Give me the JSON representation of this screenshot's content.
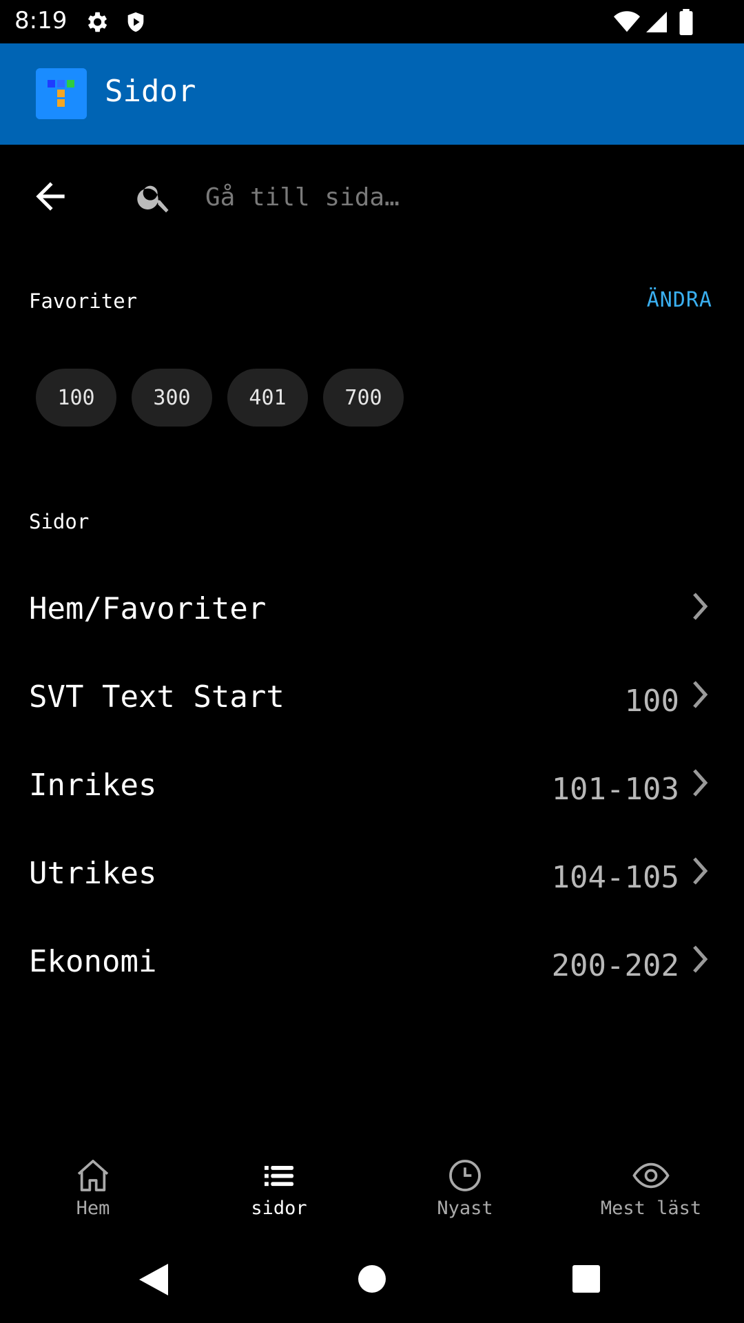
{
  "status_bar": {
    "time": "8:19",
    "icons": [
      "gear-icon",
      "shield-icon",
      "wifi-icon",
      "signal-icon",
      "battery-icon"
    ]
  },
  "app_bar": {
    "title": "Sidor",
    "logo_colors": [
      "#1e5bff",
      "#2ecc40",
      "#1e90ff",
      "#f5a623",
      "#f5a623"
    ]
  },
  "search": {
    "placeholder": "Gå till sida…",
    "value": ""
  },
  "favorites": {
    "heading": "Favoriter",
    "edit_label": "ÄNDRA",
    "chips": [
      "100",
      "300",
      "401",
      "700"
    ]
  },
  "pages": {
    "heading": "Sidor",
    "items": [
      {
        "label": "Hem/Favoriter",
        "range": ""
      },
      {
        "label": "SVT Text Start",
        "range": "100"
      },
      {
        "label": "Inrikes",
        "range": "101-103"
      },
      {
        "label": "Utrikes",
        "range": "104-105"
      },
      {
        "label": "Ekonomi",
        "range": "200-202"
      }
    ]
  },
  "bottom_nav": {
    "items": [
      {
        "label": "Hem",
        "icon": "home-icon",
        "active": false
      },
      {
        "label": "sidor",
        "icon": "list-icon",
        "active": true
      },
      {
        "label": "Nyast",
        "icon": "clock-icon",
        "active": false
      },
      {
        "label": "Mest läst",
        "icon": "eye-icon",
        "active": false
      }
    ]
  },
  "colors": {
    "app_bar": "#0064b4",
    "accent": "#3aaff0",
    "chip_bg": "#222222"
  }
}
